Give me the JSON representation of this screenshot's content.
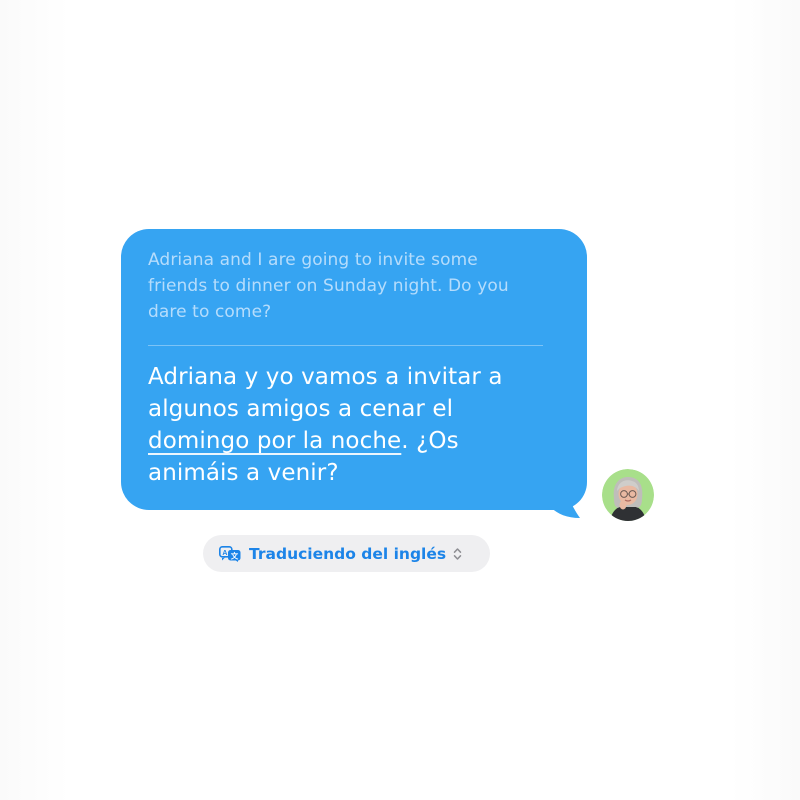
{
  "message": {
    "original_lines": [
      "Adriana and I are going to invite some",
      "friends to dinner on Sunday night. Do you",
      "dare to come?"
    ],
    "translated": {
      "line1": "Adriana y yo vamos a invitar a",
      "line2": "algunos amigos a cenar el",
      "line3_underlined": "domingo por la noche",
      "line3_rest": ". ¿Os",
      "line4": "animáis a venir?"
    }
  },
  "translation_pill": {
    "label": "Traduciendo del inglés",
    "icon": "translate-icon",
    "chevron": "chevron-up-down-icon"
  },
  "colors": {
    "bubble": "#36a4f2",
    "pill_background": "#efeff1",
    "pill_text": "#1c84e8",
    "avatar_background": "#a8df8a"
  }
}
